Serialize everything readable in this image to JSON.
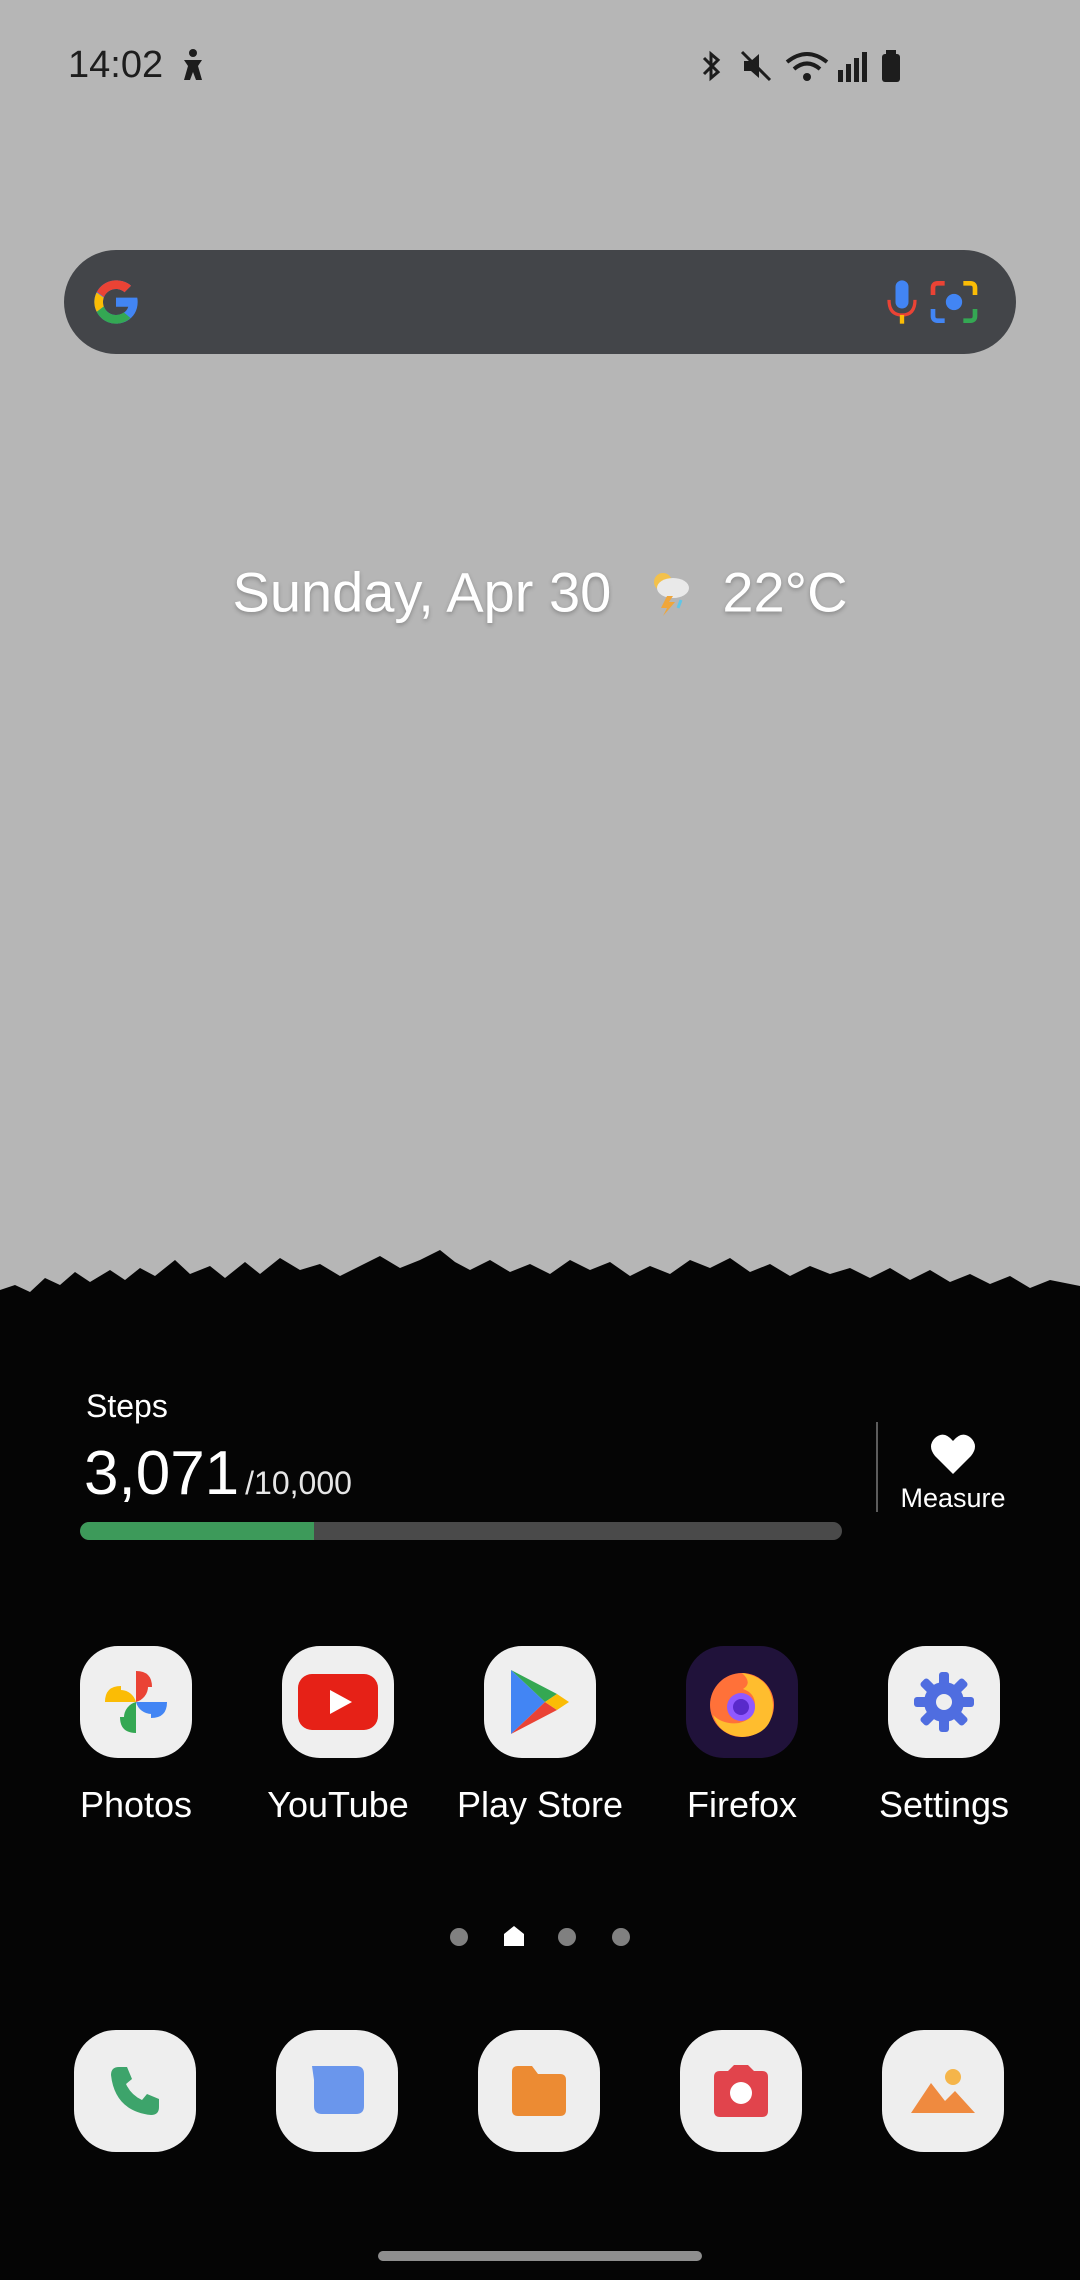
{
  "status_bar": {
    "time": "14:02",
    "icons": [
      "accessibility-icon",
      "bluetooth-icon",
      "mute-icon",
      "wifi-icon",
      "signal-icon",
      "battery-icon"
    ]
  },
  "search": {
    "icons": [
      "google-logo-icon",
      "microphone-icon",
      "google-lens-icon"
    ]
  },
  "date_weather": {
    "date": "Sunday, Apr 30",
    "temperature": "22°C",
    "weather_icon": "thunderstorm-icon"
  },
  "steps_widget": {
    "label": "Steps",
    "count": "3,071",
    "goal": "/10,000",
    "progress": 0.3071,
    "measure_label": "Measure",
    "measure_icon": "heart-icon"
  },
  "apps": [
    {
      "label": "Photos",
      "icon": "photos-icon"
    },
    {
      "label": "YouTube",
      "icon": "youtube-icon"
    },
    {
      "label": "Play Store",
      "icon": "play-store-icon"
    },
    {
      "label": "Firefox",
      "icon": "firefox-icon"
    },
    {
      "label": "Settings",
      "icon": "settings-icon"
    }
  ],
  "page_indicator": {
    "pages": 4,
    "home_index": 1
  },
  "dock": [
    {
      "icon": "phone-icon"
    },
    {
      "icon": "messages-icon"
    },
    {
      "icon": "files-icon"
    },
    {
      "icon": "camera-icon"
    },
    {
      "icon": "gallery-icon"
    }
  ],
  "colors": {
    "steps_progress": "#3d9a5a",
    "search_bar": "#434549",
    "wallpaper_sky": "#b6b6b6",
    "wallpaper_ground": "#050505"
  }
}
